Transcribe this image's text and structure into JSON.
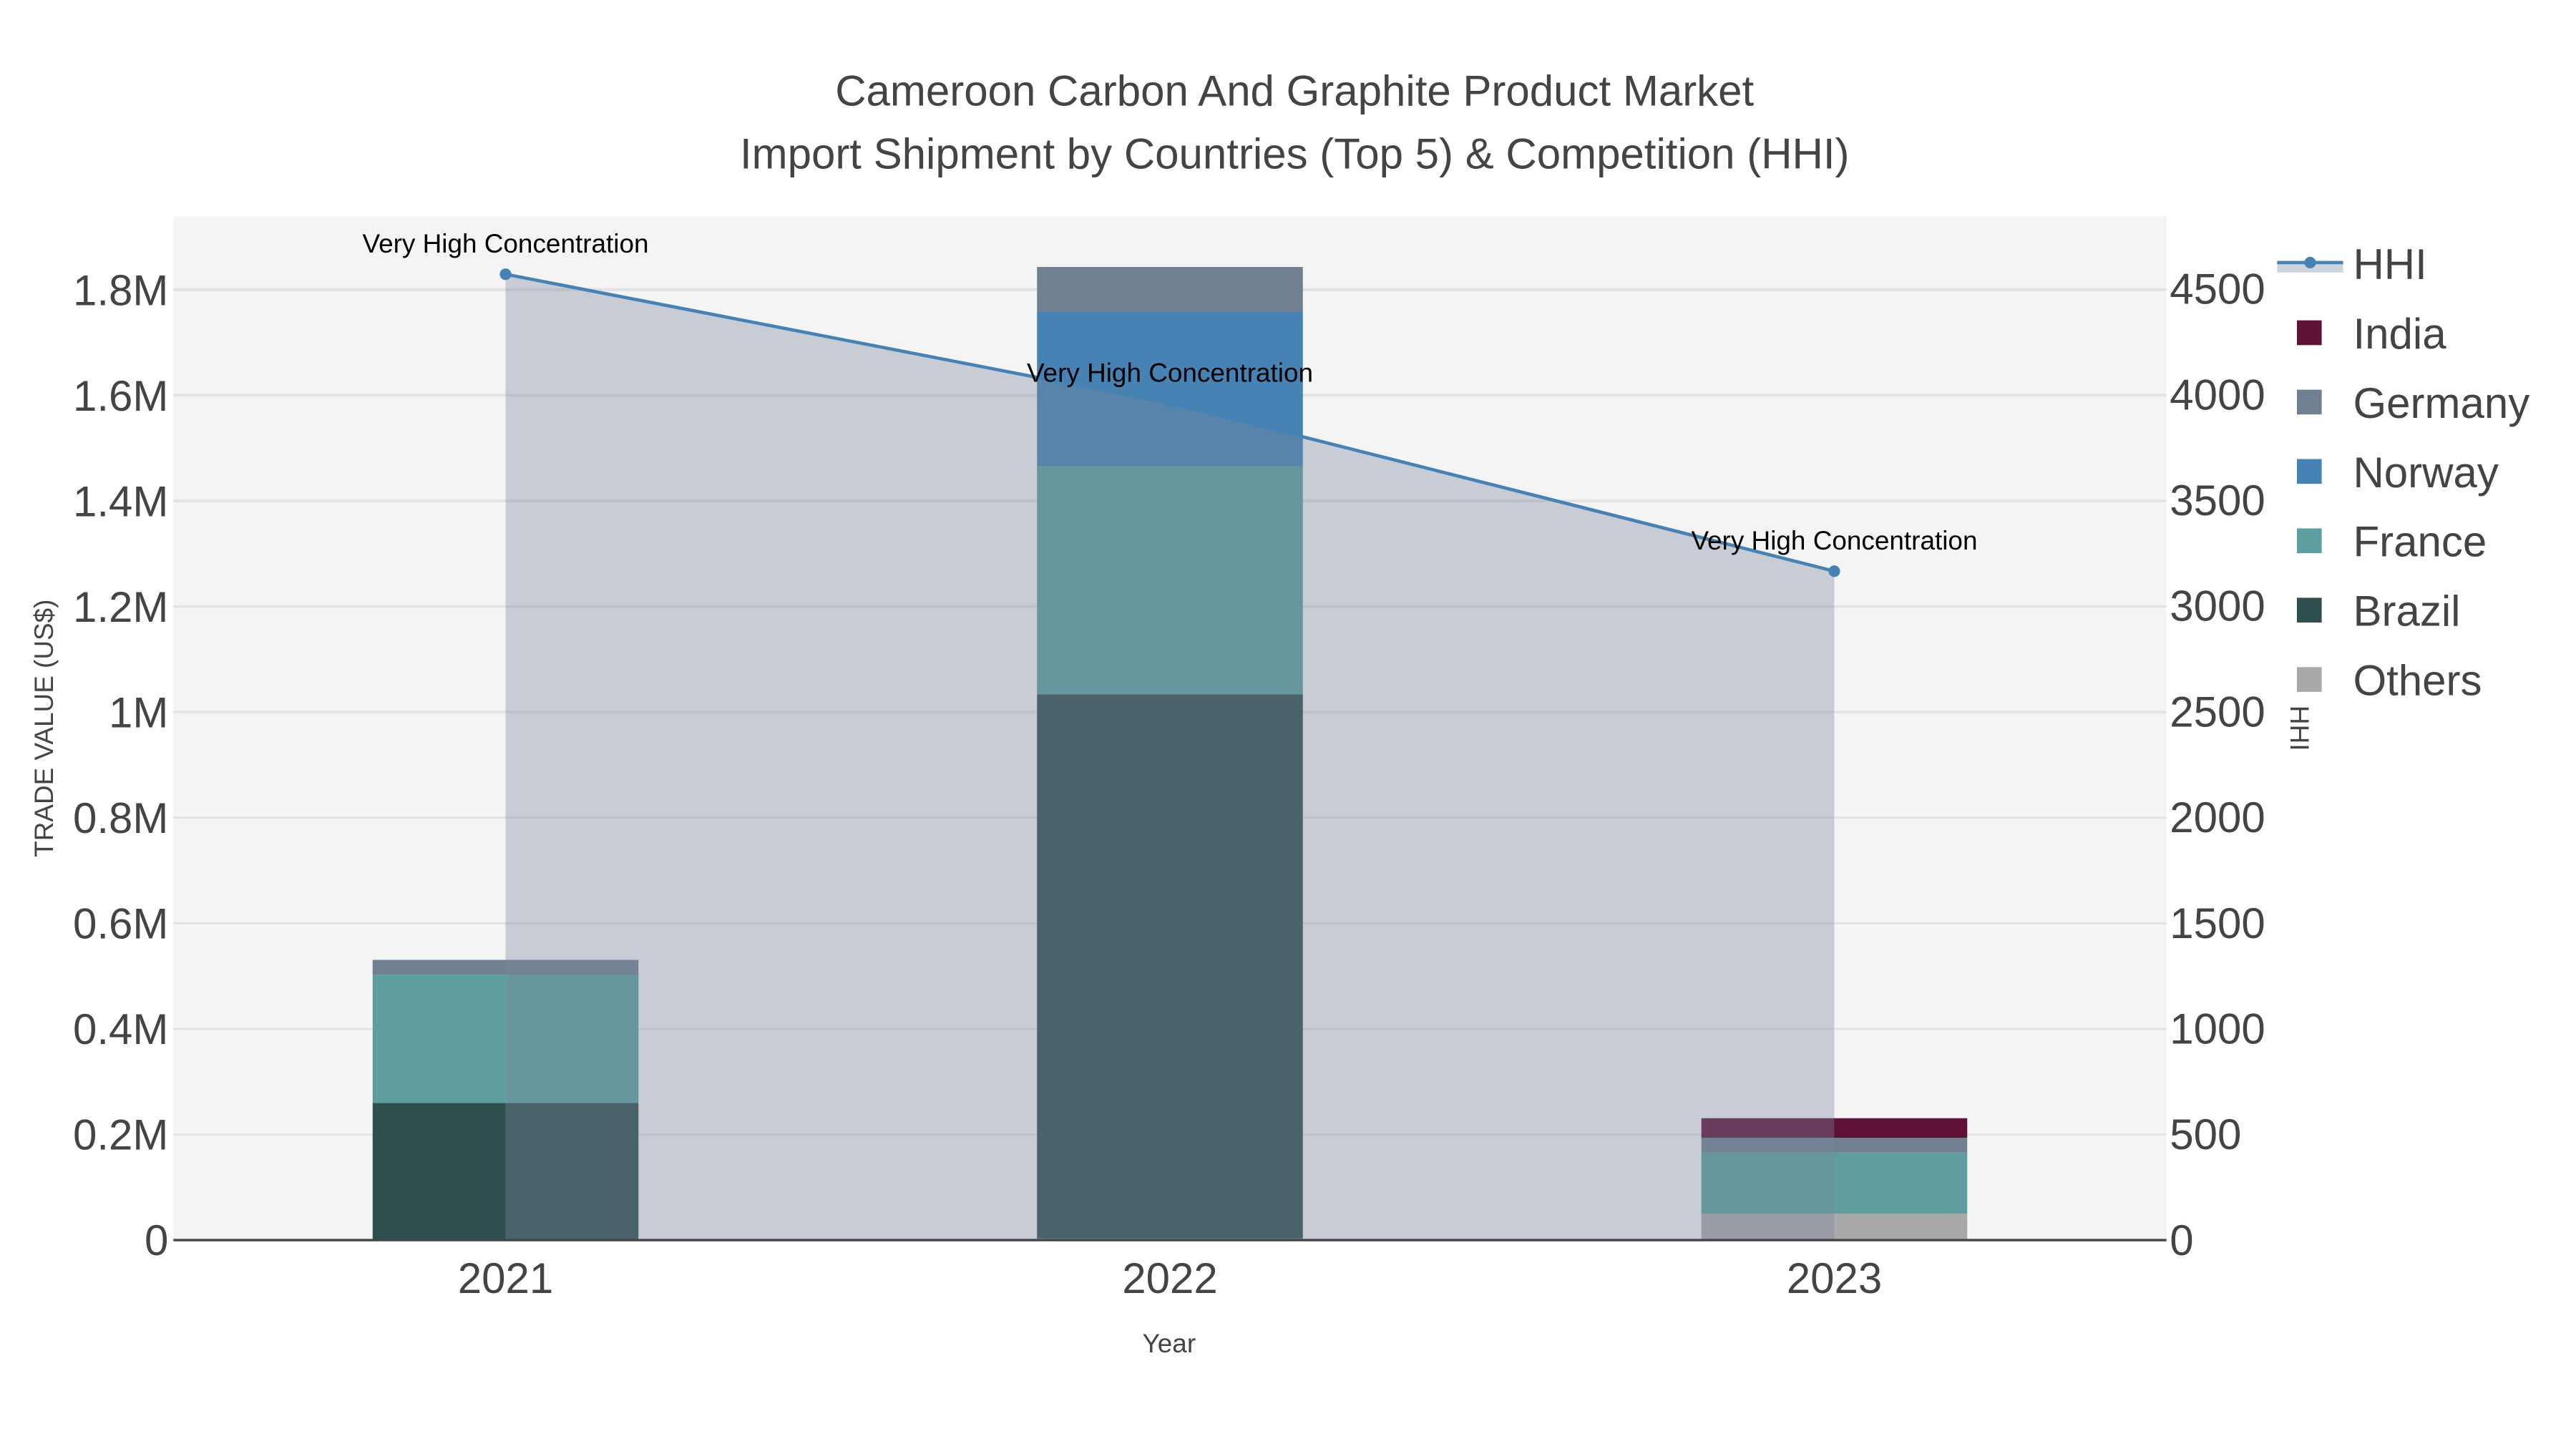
{
  "chart_data": {
    "type": "bar",
    "title": "Cameroon Carbon And Graphite Product Market",
    "subtitle": "Import Shipment by Countries (Top 5) & Competition (HHI)",
    "xlabel": "Year",
    "ylabel": "TRADE VALUE (US$)",
    "y2label": "HHI",
    "categories": [
      "2021",
      "2022",
      "2023"
    ],
    "ylim": [
      0,
      1940000
    ],
    "y2lim": [
      0,
      4844
    ],
    "yticks": [
      0,
      200000,
      400000,
      600000,
      800000,
      1000000,
      1200000,
      1400000,
      1600000,
      1800000
    ],
    "ytick_labels": [
      "0",
      "0.2M",
      "0.4M",
      "0.6M",
      "0.8M",
      "1M",
      "1.2M",
      "1.4M",
      "1.6M",
      "1.8M"
    ],
    "y2ticks": [
      0,
      500,
      1000,
      1500,
      2000,
      2500,
      3000,
      3500,
      4000,
      4500
    ],
    "y2tick_labels": [
      "0",
      "500",
      "1000",
      "1500",
      "2000",
      "2500",
      "3000",
      "3500",
      "4000",
      "4500"
    ],
    "barmode": "stack",
    "series": [
      {
        "name": "Others",
        "color": "#a9a9a9",
        "values": [
          0,
          3000,
          50000
        ]
      },
      {
        "name": "Brazil",
        "color": "#2f4f4f",
        "values": [
          260000,
          1031000,
          0
        ]
      },
      {
        "name": "France",
        "color": "#5f9ea0",
        "values": [
          243000,
          432000,
          116000
        ]
      },
      {
        "name": "Norway",
        "color": "#4682b4",
        "values": [
          0,
          294000,
          0
        ]
      },
      {
        "name": "Germany",
        "color": "#708090",
        "values": [
          28000,
          84000,
          28000
        ]
      },
      {
        "name": "India",
        "color": "#601236",
        "values": [
          0,
          0,
          37000
        ]
      }
    ],
    "line": {
      "name": "HHI",
      "color": "#4682b4",
      "values": [
        4570,
        3960,
        3165
      ],
      "axis": "right",
      "fill": "tozeroy"
    },
    "annotations": [
      "Very High Concentration",
      "Very High Concentration",
      "Very High Concentration"
    ],
    "legend_order": [
      "HHI",
      "India",
      "Germany",
      "Norway",
      "France",
      "Brazil",
      "Others"
    ],
    "legend_position": "right",
    "grid": true
  }
}
